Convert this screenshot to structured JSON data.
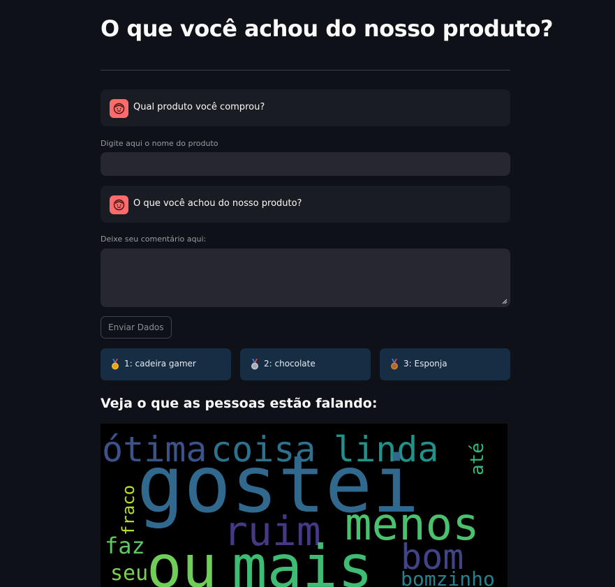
{
  "page": {
    "title": "O que você achou do nosso produto?"
  },
  "chat": {
    "question_product": "Qual produto você comprou?",
    "question_opinion": "O que você achou do nosso produto?"
  },
  "form": {
    "product_label": "Digite aqui o nome do produto",
    "product_value": "",
    "comment_label": "Deixe seu comentário aqui:",
    "comment_value": "",
    "submit_label": "Enviar Dados"
  },
  "ranking": [
    {
      "label": "1: cadeira gamer",
      "medal": "gold-medal-icon",
      "color": "#f5b82e"
    },
    {
      "label": "2: chocolate",
      "medal": "silver-medal-icon",
      "color": "#c0c6cf"
    },
    {
      "label": "3: Esponja",
      "medal": "bronze-medal-icon",
      "color": "#cd7f32"
    }
  ],
  "wordcloud": {
    "heading": "Veja o que as pessoas estão falando:",
    "words": [
      {
        "text": "ótima",
        "color": "#3b528b"
      },
      {
        "text": "coisa",
        "color": "#2c728e"
      },
      {
        "text": "linda",
        "color": "#21918c"
      },
      {
        "text": "até",
        "color": "#35b779"
      },
      {
        "text": "gostei",
        "color": "#31688e"
      },
      {
        "text": "fraco",
        "color": "#b5de2b"
      },
      {
        "text": "ruim",
        "color": "#443983"
      },
      {
        "text": "menos",
        "color": "#4ac16d"
      },
      {
        "text": "faz",
        "color": "#5ec962"
      },
      {
        "text": "ou",
        "color": "#6ece58"
      },
      {
        "text": "mais",
        "color": "#3fbc73"
      },
      {
        "text": "bom",
        "color": "#414487"
      },
      {
        "text": "seu",
        "color": "#7ad151"
      },
      {
        "text": "bomzinho",
        "color": "#26828e"
      }
    ]
  },
  "colors": {
    "background": "#0e1117",
    "avatar": "#ff6b6b",
    "card": "#172d43"
  }
}
